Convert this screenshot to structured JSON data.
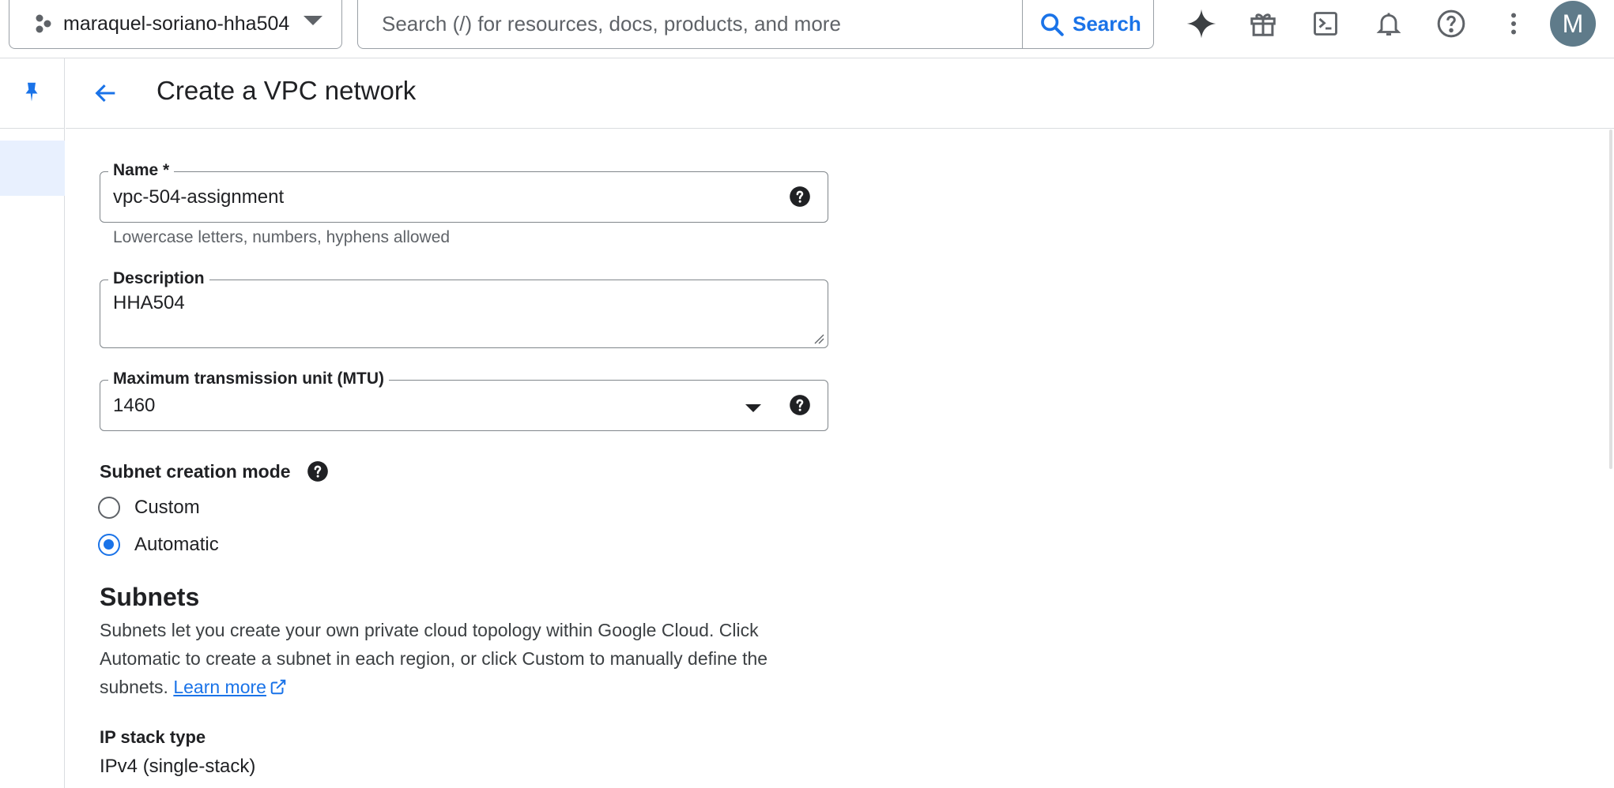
{
  "topbar": {
    "project_name": "maraquel-soriano-hha504",
    "search_placeholder": "Search (/) for resources, docs, products, and more",
    "search_button_label": "Search",
    "avatar_initial": "M"
  },
  "header": {
    "title": "Create a VPC network"
  },
  "form": {
    "name": {
      "label": "Name *",
      "value": "vpc-504-assignment",
      "hint": "Lowercase letters, numbers, hyphens allowed"
    },
    "description": {
      "label": "Description",
      "value": "HHA504"
    },
    "mtu": {
      "label": "Maximum transmission unit (MTU)",
      "value": "1460"
    },
    "subnet_mode": {
      "label": "Subnet creation mode",
      "options": [
        "Custom",
        "Automatic"
      ],
      "selected": "Automatic"
    }
  },
  "subnets": {
    "title": "Subnets",
    "description": "Subnets let you create your own private cloud topology within Google Cloud. Click Automatic to create a subnet in each region, or click Custom to manually define the subnets.",
    "learn_more": "Learn more"
  },
  "ip_stack": {
    "label": "IP stack type",
    "value": "IPv4 (single-stack)"
  },
  "colors": {
    "accent": "#1a73e8",
    "rail_active": "#e8f0fe",
    "border": "#dadce0"
  },
  "icons": [
    "project-dots-icon",
    "caret-down-icon",
    "search-icon",
    "gemini-spark-icon",
    "gift-icon",
    "cloud-shell-icon",
    "bell-icon",
    "help-circle-icon",
    "more-vert-icon",
    "pin-icon",
    "back-arrow-icon",
    "help-icon",
    "external-link-icon"
  ]
}
